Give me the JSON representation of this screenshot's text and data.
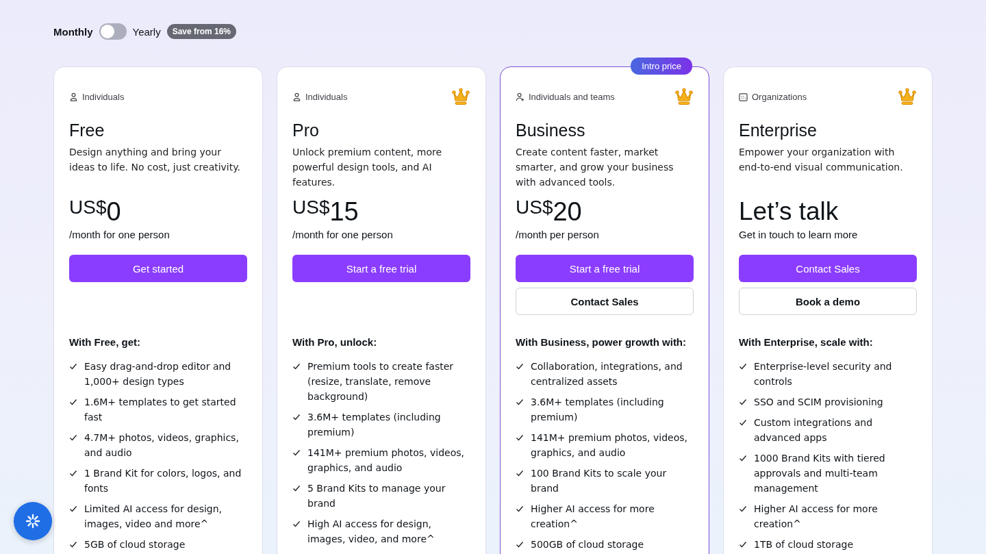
{
  "billing": {
    "monthly_label": "Monthly",
    "yearly_label": "Yearly",
    "toggle": {
      "on": false
    },
    "badge": "Save from 16%"
  },
  "plans": [
    {
      "audience": "Individuals",
      "kind": "person",
      "premium": false,
      "highlighted": false,
      "name": "Free",
      "description": "Design anything and bring your ideas to life. No cost, just creativity.",
      "price": {
        "kind": "amount",
        "currency": "US$",
        "amount": "0"
      },
      "price_note": "/month for one person",
      "primary_button": "Get started",
      "features_title": "With Free, get:",
      "features": [
        "Easy drag-and-drop editor and 1,000+ design types",
        "1.6M+ templates to get started fast",
        "4.7M+ photos, videos, graphics, and audio",
        "1 Brand Kit for colors, logos, and fonts",
        "Limited AI access for design, images, video and more^",
        "5GB of cloud storage"
      ]
    },
    {
      "audience": "Individuals",
      "kind": "person",
      "premium": true,
      "highlighted": false,
      "name": "Pro",
      "description": "Unlock premium content, more powerful design tools, and AI features.",
      "price": {
        "kind": "amount",
        "currency": "US$",
        "amount": "15"
      },
      "price_note": "/month for one person",
      "primary_button": "Start a free trial",
      "features_title": "With Pro, unlock:",
      "features": [
        "Premium tools to create faster (resize, translate, remove background)",
        "3.6M+ templates (including premium)",
        "141M+ premium photos, videos, graphics, and audio",
        "5 Brand Kits to manage your brand",
        "High AI access for design, images, video, and more^"
      ]
    },
    {
      "audience": "Individuals and teams",
      "kind": "person-plus",
      "premium": true,
      "highlighted": true,
      "badge": "Intro price",
      "name": "Business",
      "description": "Create content faster, market smarter, and grow your business with advanced tools.",
      "price": {
        "kind": "amount",
        "currency": "US$",
        "amount": "20"
      },
      "price_note": "/month per person",
      "primary_button": "Start a free trial",
      "secondary_button": "Contact Sales",
      "features_title": "With Business, power growth with:",
      "features": [
        "Collaboration, integrations, and centralized assets",
        "3.6M+ templates (including premium)",
        "141M+ premium photos, videos, graphics, and audio",
        "100 Brand Kits to scale your brand",
        "Higher AI access for more creation^",
        "500GB of cloud storage"
      ]
    },
    {
      "audience": "Organizations",
      "kind": "building",
      "premium": true,
      "highlighted": false,
      "name": "Enterprise",
      "description": "Empower your organization with end-to-end visual communication.",
      "price": {
        "kind": "text",
        "text": "Let’s talk"
      },
      "price_note": "Get in touch to learn more",
      "primary_button": "Contact Sales",
      "secondary_button": "Book a demo",
      "features_title": "With Enterprise, scale with:",
      "features": [
        "Enterprise-level security and controls",
        "SSO and SCIM provisioning",
        "Custom integrations and advanced apps",
        "1000 Brand Kits with tiered approvals and multi-team management",
        "Higher AI access for more creation^",
        "1TB of cloud storage"
      ]
    }
  ]
}
